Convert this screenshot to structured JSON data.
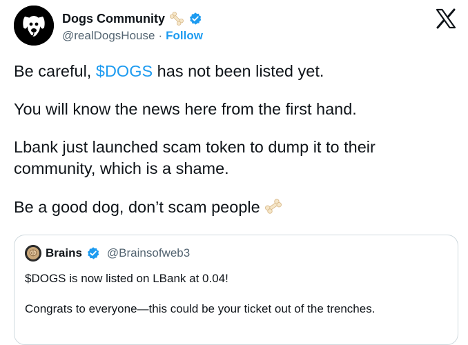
{
  "author": {
    "display_name": "Dogs Community",
    "handle": "@realDogsHouse",
    "separator": "·",
    "follow_label": "Follow"
  },
  "tweet": {
    "line1_pre": "Be careful, ",
    "line1_cashtag": "$DOGS",
    "line1_post": " has not been listed yet.",
    "para2": "You will know the news here from the first hand.",
    "para3": "Lbank just launched scam token to dump it to their community, which is a shame.",
    "para4": "Be a good dog, don’t scam people"
  },
  "quote": {
    "display_name": "Brains",
    "handle": "@Brainsofweb3",
    "line1": "$DOGS is now listed on LBank at 0.04!",
    "line2": "Congrats to everyone—this could be your ticket out of the trenches."
  },
  "icons": {
    "avatar": "dog-avatar-icon",
    "emoji": "bone-icon",
    "verified": "verified-badge-icon",
    "logo": "x-logo-icon"
  },
  "colors": {
    "accent": "#1d9bf0",
    "text": "#0f1419",
    "secondary": "#536471",
    "border": "#cfd9de"
  }
}
